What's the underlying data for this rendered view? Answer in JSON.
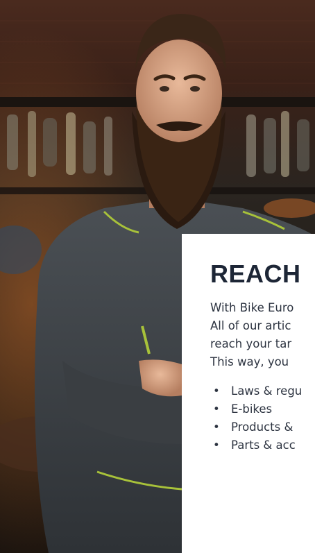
{
  "hero": {
    "image_icon": "mechanic-photo"
  },
  "card": {
    "title": "REACH",
    "body_lines": [
      "With Bike Euro",
      "All of our artic",
      "reach your tar",
      "This way, you"
    ],
    "list_items": [
      "Laws & regu",
      "E-bikes",
      "Products &",
      "Parts & acc"
    ],
    "bullet": "•"
  },
  "colors": {
    "card_bg": "#ffffff",
    "title": "#1d2636",
    "text": "#2c3340"
  }
}
